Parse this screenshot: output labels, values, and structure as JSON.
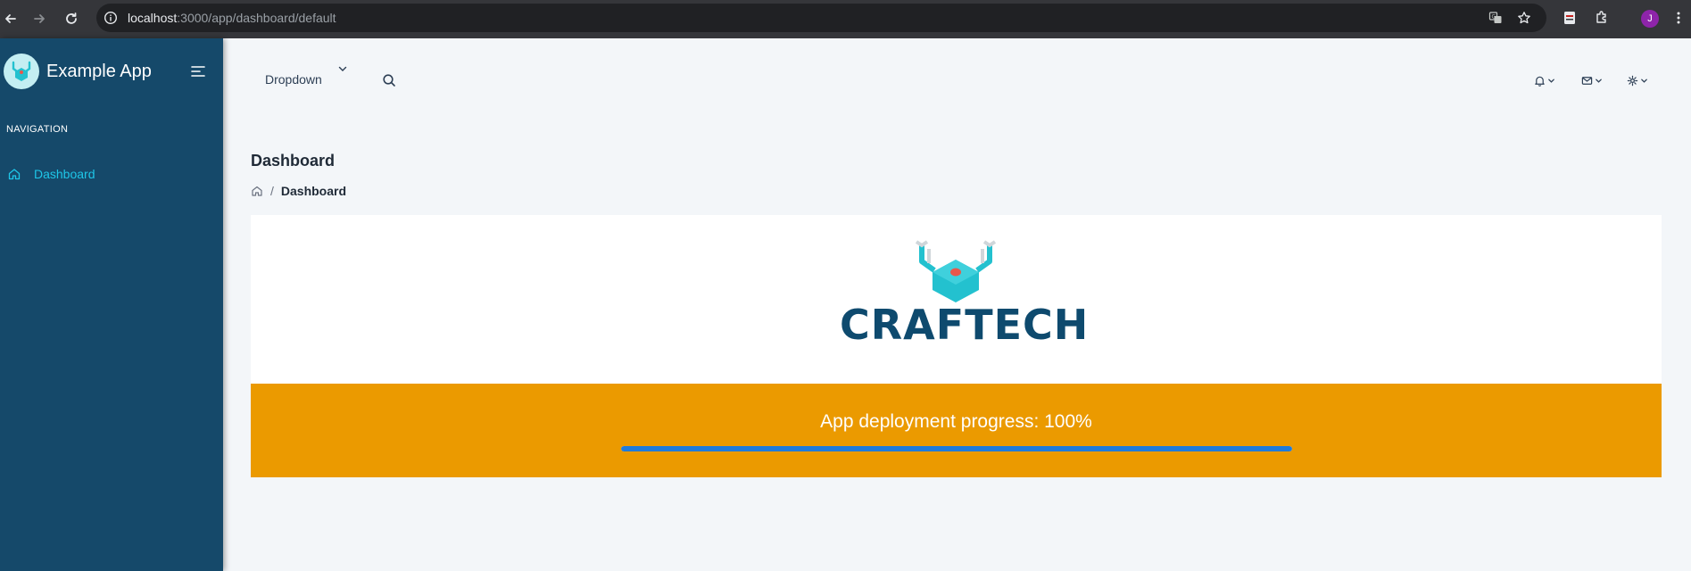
{
  "browser": {
    "url_host": "localhost",
    "url_rest": ":3000/app/dashboard/default",
    "profile_initial": "J"
  },
  "sidebar": {
    "app_name": "Example App",
    "nav_header": "NAVIGATION",
    "items": [
      {
        "label": "Dashboard",
        "icon": "home-icon",
        "active": true
      }
    ]
  },
  "header": {
    "dropdown_label": "Dropdown",
    "icons": [
      "bell-icon",
      "mail-icon",
      "gear-icon"
    ]
  },
  "page": {
    "title": "Dashboard",
    "breadcrumb": {
      "current": "Dashboard"
    }
  },
  "card": {
    "logo_text": "CRAFTECH"
  },
  "progress": {
    "label": "App deployment progress: 100%",
    "percent": 100
  },
  "colors": {
    "sidebar_bg": "#15496a",
    "accent_cyan": "#1ec6e8",
    "progress_bg": "#eb9a00",
    "progress_fill": "#1e7bdc",
    "logo_text": "#0e4a6e",
    "logo_teal": "#23c1cf"
  }
}
